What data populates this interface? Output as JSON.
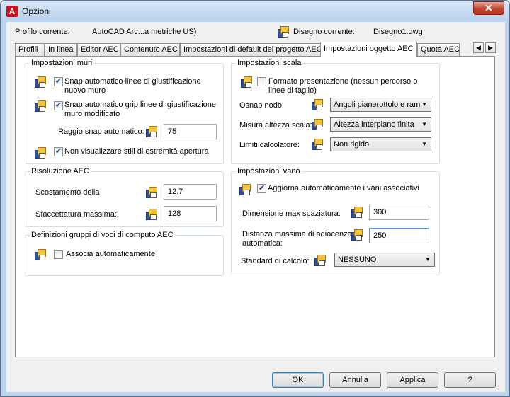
{
  "window": {
    "title": "Opzioni",
    "close_glyph": "✕"
  },
  "profile": {
    "current_label": "Profilo corrente:",
    "current_value": "AutoCAD Arc...a metriche US)",
    "drawing_label": "Disegno corrente:",
    "drawing_value": "Disegno1.dwg"
  },
  "tabs": [
    {
      "label": "Profili"
    },
    {
      "label": "In linea"
    },
    {
      "label": "Editor AEC"
    },
    {
      "label": "Contenuto AEC"
    },
    {
      "label": "Impostazioni di default del progetto AEC"
    },
    {
      "label": "Impostazioni oggetto AEC"
    },
    {
      "label": "Quota AEC"
    }
  ],
  "active_tab": "Impostazioni oggetto AEC",
  "walls": {
    "title": "Impostazioni muri",
    "snap_justify_line1": "Snap automatico linee di giustificazione",
    "snap_justify_line2": "nuovo muro",
    "snap_justify_checked": true,
    "snap_grip_line1": "Snap automatico grip linee di giustificazione",
    "snap_grip_line2": "muro modificato",
    "snap_grip_checked": true,
    "radius_label": "Raggio snap automatico:",
    "radius_value": "75",
    "hide_endcap_label": "Non visualizzare stili di estremità apertura",
    "hide_endcap_checked": true
  },
  "aec_resolution": {
    "title": "Risoluzione AEC",
    "offset_label": "Scostamento della",
    "offset_value": "12.7",
    "facet_label": "Sfaccettatura massima:",
    "facet_value": "128"
  },
  "takeoff": {
    "title": "Definizioni gruppi di voci di computo AEC",
    "auto_assoc_label": "Associa automaticamente",
    "auto_assoc_checked": false
  },
  "scale": {
    "title": "Impostazioni scala",
    "presentation_line1": "Formato presentazione (nessun percorso o",
    "presentation_line2": "linee di taglio)",
    "presentation_checked": false,
    "osnap_label": "Osnap nodo:",
    "osnap_value": "Angoli pianerottolo e ram",
    "height_label": "Misura altezza scala:",
    "height_value": "Altezza interpiano finita",
    "limits_label": "Limiti calcolatore:",
    "limits_value": "Non rigido"
  },
  "opening": {
    "title": "Impostazioni vano",
    "auto_update_label": "Aggiorna automaticamente i vani associativi",
    "auto_update_checked": true,
    "max_spacing_label": "Dimensione max spaziatura:",
    "max_spacing_value": "300",
    "max_adj_line1": "Distanza massima di adiacenza",
    "max_adj_line2": "automatica:",
    "max_adj_value": "250",
    "calc_std_label": "Standard di calcolo:",
    "calc_std_value": "NESSUNO"
  },
  "buttons": {
    "ok": "OK",
    "cancel": "Annulla",
    "apply": "Applica",
    "help": "?"
  }
}
